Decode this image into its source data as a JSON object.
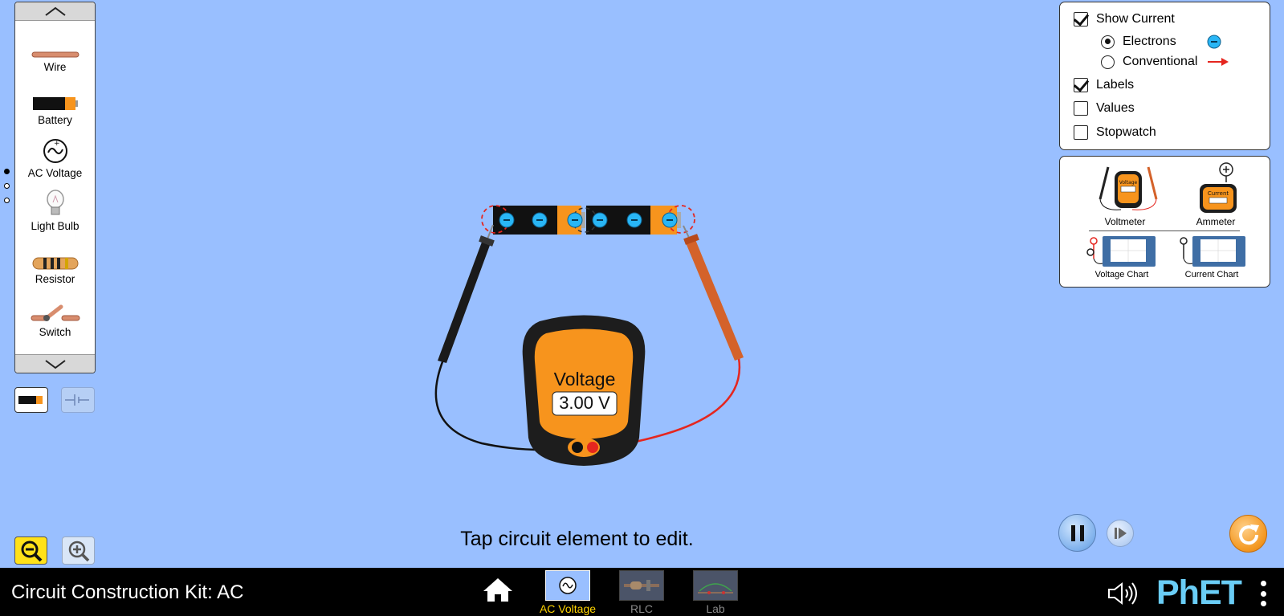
{
  "toolbox": {
    "items": [
      {
        "label": "Wire"
      },
      {
        "label": "Battery"
      },
      {
        "label": "AC Voltage"
      },
      {
        "label": "Light Bulb"
      },
      {
        "label": "Resistor"
      },
      {
        "label": "Switch"
      }
    ]
  },
  "display_options": {
    "show_current": {
      "label": "Show Current",
      "checked": true
    },
    "electrons": {
      "label": "Electrons",
      "selected": true
    },
    "conventional": {
      "label": "Conventional",
      "selected": false
    },
    "labels": {
      "label": "Labels",
      "checked": true
    },
    "values": {
      "label": "Values",
      "checked": false
    },
    "stopwatch": {
      "label": "Stopwatch",
      "checked": false
    }
  },
  "tools": {
    "voltmeter": "Voltmeter",
    "ammeter": "Ammeter",
    "voltage_chart": "Voltage Chart",
    "current_chart": "Current Chart",
    "voltmeter_icon_label": "Voltage",
    "ammeter_icon_label": "Current"
  },
  "voltmeter": {
    "title": "Voltage",
    "reading": "3.00 V"
  },
  "hint": "Tap circuit element to edit.",
  "navbar": {
    "title": "Circuit Construction Kit: AC",
    "screens": [
      {
        "label": "AC Voltage",
        "selected": true
      },
      {
        "label": "RLC",
        "selected": false
      },
      {
        "label": "Lab",
        "selected": false
      }
    ],
    "logo": "PhET"
  },
  "colors": {
    "background": "#99bfff",
    "selected_screen": "#ffd400",
    "unselected_screen": "#8a8a8a",
    "meter_orange": "#f7941d",
    "electron_blue": "#29b6f6",
    "red_probe": "#e5261f"
  }
}
